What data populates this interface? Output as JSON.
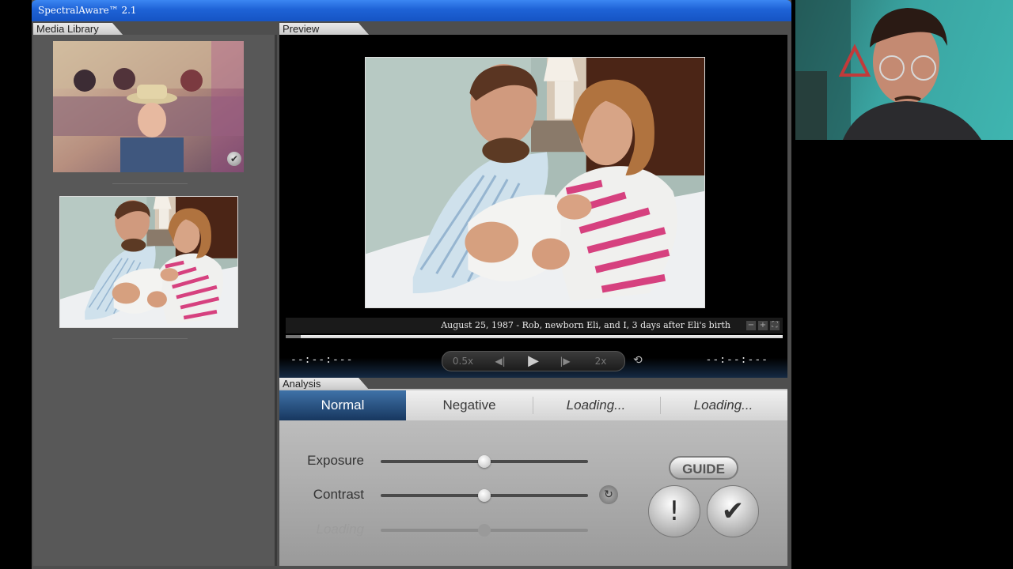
{
  "window": {
    "title": "SpectralAware™ 2.1"
  },
  "panels": {
    "media_library": "Media Library",
    "preview": "Preview",
    "analysis": "Analysis"
  },
  "preview": {
    "caption": "August 25, 1987 - Rob, newborn Eli, and I, 3 days after Eli's birth",
    "mini_controls": [
      "−",
      "+",
      "⛶"
    ],
    "seek_progress": 0.03
  },
  "transport": {
    "time_left": "--:--:---",
    "time_right": "--:--:---",
    "speed_slow": "0.5x",
    "speed_fast": "2x"
  },
  "analysis": {
    "tabs": [
      "Normal",
      "Negative",
      "Loading...",
      "Loading..."
    ],
    "active_tab": 0,
    "sliders": [
      {
        "label": "Exposure",
        "value": 0.5,
        "enabled": true
      },
      {
        "label": "Contrast",
        "value": 0.5,
        "enabled": true
      },
      {
        "label": "Loading",
        "value": 0.5,
        "enabled": false
      }
    ],
    "guide_label": "GUIDE",
    "alert_symbol": "!",
    "confirm_symbol": "✔"
  },
  "icons": {
    "play": "play-icon",
    "prev": "step-back-icon",
    "next": "step-forward-icon",
    "loop": "loop-icon",
    "reset": "reset-icon",
    "check": "check-icon"
  }
}
